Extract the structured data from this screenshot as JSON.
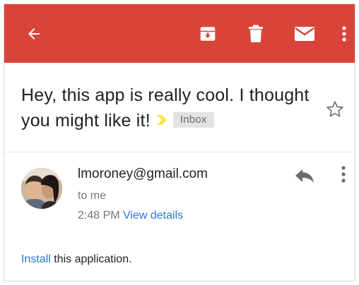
{
  "toolbar": {
    "background": "#d9443a",
    "icons": {
      "back": "arrow-back-icon",
      "archive": "archive-icon",
      "delete": "trash-icon",
      "mark_unread": "mail-icon",
      "more": "more-vert-icon"
    }
  },
  "message": {
    "subject": "Hey, this app is really cool. I thought you might like it!",
    "label": "Inbox",
    "label_marker_color": "#f5e642",
    "sender": "lmoroney@gmail.com",
    "recipient": "to me",
    "time": "2:48 PM",
    "view_details": "View details",
    "body_link": "Install",
    "body_rest": " this application."
  },
  "colors": {
    "link": "#2a78d6"
  }
}
